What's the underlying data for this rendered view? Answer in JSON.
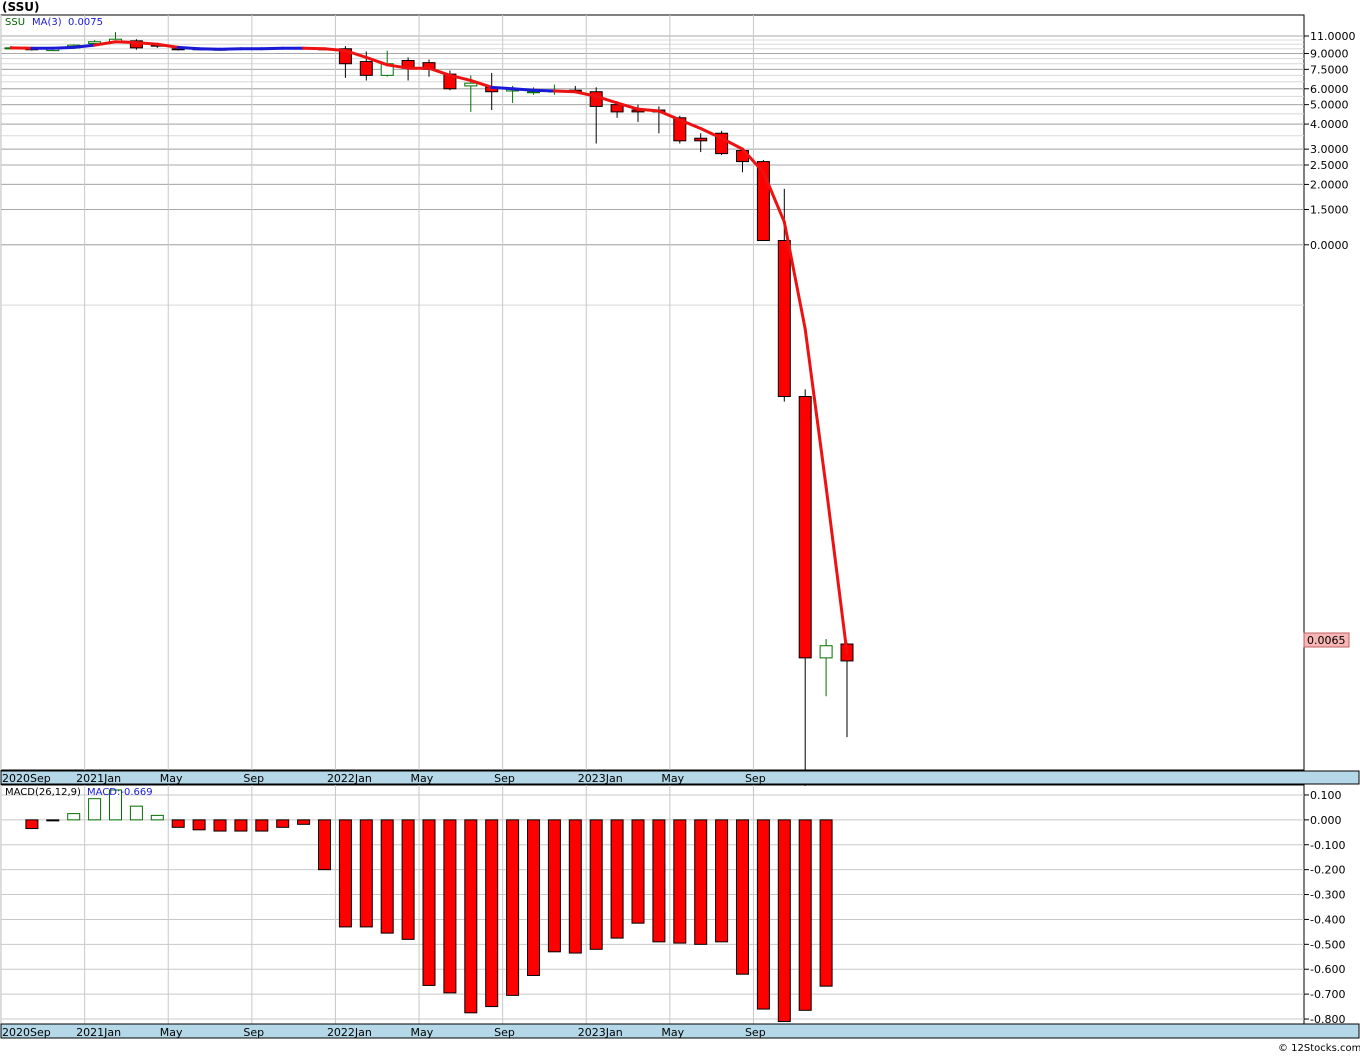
{
  "header": {
    "ticker": "(SSU)",
    "symbol": "SSU",
    "ma_label": "MA(3)",
    "ma_value": "0.0075",
    "macd_params": "MACD(26,12,9)",
    "macd_value": "MACD:-0.669",
    "last_price": "0.0065",
    "footer": "© 12Stocks.com"
  },
  "colors": {
    "down": "#ff0000",
    "up": "#ffffff",
    "up_outline": "#007000",
    "ma_down": "#ee1111",
    "ma_up": "#1a1ad6",
    "axis_bar": "#b4d8e8",
    "grid": "#c8c8c8"
  },
  "chart_data": [
    {
      "type": "candlestick",
      "title": "(SSU)",
      "scale": "log",
      "ylim": [
        0.0024,
        14
      ],
      "x_tick_labels": [
        "2020Sep",
        "2021Jan",
        "May",
        "Sep",
        "2022Jan",
        "May",
        "Sep",
        "2023Jan",
        "May",
        "Sep"
      ],
      "x_tick_index": [
        0,
        4,
        8,
        12,
        16,
        20,
        24,
        28,
        32,
        36
      ],
      "y_tick_labels": [
        "11.0000",
        "9.0000",
        "7.5000",
        "6.0000",
        "5.0000",
        "4.0000",
        "3.0000",
        "2.5000",
        "2.0000",
        "1.5000",
        "0.0000"
      ],
      "y_tick_values": [
        11.0,
        9.0,
        7.5,
        6.0,
        5.0,
        4.0,
        3.0,
        2.5,
        2.0,
        1.5,
        1.0
      ],
      "candles": [
        {
          "o": 9.6,
          "h": 9.8,
          "l": 9.4,
          "c": 9.6
        },
        {
          "o": 9.5,
          "h": 9.7,
          "l": 9.3,
          "c": 9.45
        },
        {
          "o": 9.3,
          "h": 9.7,
          "l": 9.25,
          "c": 9.6
        },
        {
          "o": 9.6,
          "h": 10.0,
          "l": 9.6,
          "c": 9.9
        },
        {
          "o": 10.1,
          "h": 10.5,
          "l": 10.0,
          "c": 10.3
        },
        {
          "o": 10.3,
          "h": 11.5,
          "l": 10.2,
          "c": 10.6
        },
        {
          "o": 10.4,
          "h": 10.6,
          "l": 9.4,
          "c": 9.6
        },
        {
          "o": 9.9,
          "h": 10.1,
          "l": 9.6,
          "c": 9.8
        },
        {
          "o": 9.5,
          "h": 9.6,
          "l": 9.3,
          "c": 9.45
        },
        {
          "o": 9.5,
          "h": 9.6,
          "l": 9.4,
          "c": 9.45
        },
        {
          "o": 9.45,
          "h": 9.55,
          "l": 9.35,
          "c": 9.45
        },
        {
          "o": 9.5,
          "h": 9.6,
          "l": 9.45,
          "c": 9.55
        },
        {
          "o": 9.55,
          "h": 9.65,
          "l": 9.45,
          "c": 9.55
        },
        {
          "o": 9.6,
          "h": 9.7,
          "l": 9.5,
          "c": 9.6
        },
        {
          "o": 9.6,
          "h": 9.7,
          "l": 9.45,
          "c": 9.5
        },
        {
          "o": 9.5,
          "h": 9.6,
          "l": 9.4,
          "c": 9.45
        },
        {
          "o": 9.5,
          "h": 9.8,
          "l": 6.8,
          "c": 8.0
        },
        {
          "o": 8.2,
          "h": 9.2,
          "l": 6.6,
          "c": 7.0
        },
        {
          "o": 7.0,
          "h": 9.3,
          "l": 6.9,
          "c": 8.0
        },
        {
          "o": 8.3,
          "h": 8.6,
          "l": 6.6,
          "c": 7.6
        },
        {
          "o": 8.1,
          "h": 8.4,
          "l": 6.9,
          "c": 7.5
        },
        {
          "o": 7.1,
          "h": 7.4,
          "l": 5.9,
          "c": 6.0
        },
        {
          "o": 6.2,
          "h": 7.0,
          "l": 4.6,
          "c": 6.4
        },
        {
          "o": 6.1,
          "h": 7.2,
          "l": 4.7,
          "c": 5.8
        },
        {
          "o": 5.85,
          "h": 6.2,
          "l": 5.1,
          "c": 6.0
        },
        {
          "o": 5.8,
          "h": 6.1,
          "l": 5.6,
          "c": 5.8
        },
        {
          "o": 5.8,
          "h": 6.3,
          "l": 5.6,
          "c": 5.85
        },
        {
          "o": 5.9,
          "h": 6.2,
          "l": 5.7,
          "c": 5.8
        },
        {
          "o": 5.8,
          "h": 6.1,
          "l": 3.2,
          "c": 4.9
        },
        {
          "o": 5.0,
          "h": 5.2,
          "l": 4.3,
          "c": 4.6
        },
        {
          "o": 4.7,
          "h": 5.0,
          "l": 4.1,
          "c": 4.6
        },
        {
          "o": 4.7,
          "h": 4.9,
          "l": 3.6,
          "c": 4.6
        },
        {
          "o": 4.3,
          "h": 4.4,
          "l": 3.2,
          "c": 3.3
        },
        {
          "o": 3.4,
          "h": 3.6,
          "l": 2.9,
          "c": 3.3
        },
        {
          "o": 3.6,
          "h": 3.7,
          "l": 2.8,
          "c": 2.85
        },
        {
          "o": 2.95,
          "h": 3.05,
          "l": 2.3,
          "c": 2.6
        },
        {
          "o": 2.6,
          "h": 2.65,
          "l": 1.05,
          "c": 1.05
        },
        {
          "o": 1.05,
          "h": 1.9,
          "l": 0.165,
          "c": 0.175
        },
        {
          "o": 0.175,
          "h": 0.19,
          "l": 0.002,
          "c": 0.0087
        },
        {
          "o": 0.0087,
          "h": 0.0108,
          "l": 0.0056,
          "c": 0.01
        },
        {
          "o": 0.0102,
          "h": 0.0104,
          "l": 0.0035,
          "c": 0.0084
        }
      ],
      "ma": [
        9.6,
        9.55,
        9.55,
        9.65,
        9.9,
        10.3,
        10.2,
        10.0,
        9.65,
        9.5,
        9.45,
        9.5,
        9.5,
        9.55,
        9.55,
        9.5,
        9.3,
        8.6,
        7.9,
        7.6,
        7.6,
        7.0,
        6.6,
        6.1,
        6.0,
        5.9,
        5.85,
        5.8,
        5.5,
        5.1,
        4.75,
        4.65,
        4.2,
        3.8,
        3.4,
        3.0,
        2.3,
        1.3,
        0.38,
        0.062,
        0.0092
      ],
      "ma_up": [
        false,
        false,
        true,
        true,
        true,
        false,
        false,
        false,
        false,
        true,
        true,
        true,
        true,
        true,
        true,
        false,
        false,
        false,
        false,
        false,
        false,
        false,
        false,
        false,
        true,
        true,
        true,
        false,
        false,
        false,
        false,
        false,
        false,
        false,
        false,
        false,
        false,
        false,
        false,
        false,
        false
      ]
    },
    {
      "type": "bar",
      "title": "MACD(26,12,9)",
      "ylim": [
        -0.82,
        0.14
      ],
      "y_tick_labels": [
        "0.100",
        "0.000",
        "-0.100",
        "-0.200",
        "-0.300",
        "-0.400",
        "-0.500",
        "-0.600",
        "-0.700",
        "-0.800"
      ],
      "y_tick_values": [
        0.1,
        0.0,
        -0.1,
        -0.2,
        -0.3,
        -0.4,
        -0.5,
        -0.6,
        -0.7,
        -0.8
      ],
      "x_tick_labels": [
        "2020Sep",
        "2021Jan",
        "May",
        "Sep",
        "2022Jan",
        "May",
        "Sep",
        "2023Jan",
        "May",
        "Sep"
      ],
      "x_tick_index": [
        0,
        4,
        8,
        12,
        16,
        20,
        24,
        28,
        32,
        36
      ],
      "values": [
        null,
        -0.035,
        -0.002,
        0.025,
        0.085,
        0.12,
        0.055,
        0.018,
        -0.03,
        -0.04,
        -0.045,
        -0.045,
        -0.045,
        -0.03,
        -0.018,
        -0.2,
        -0.43,
        -0.43,
        -0.455,
        -0.48,
        -0.665,
        -0.695,
        -0.775,
        -0.75,
        -0.705,
        -0.625,
        -0.53,
        -0.535,
        -0.52,
        -0.475,
        -0.415,
        -0.49,
        -0.495,
        -0.5,
        -0.49,
        -0.62,
        -0.76,
        -0.81,
        -0.765,
        -0.668
      ]
    }
  ]
}
